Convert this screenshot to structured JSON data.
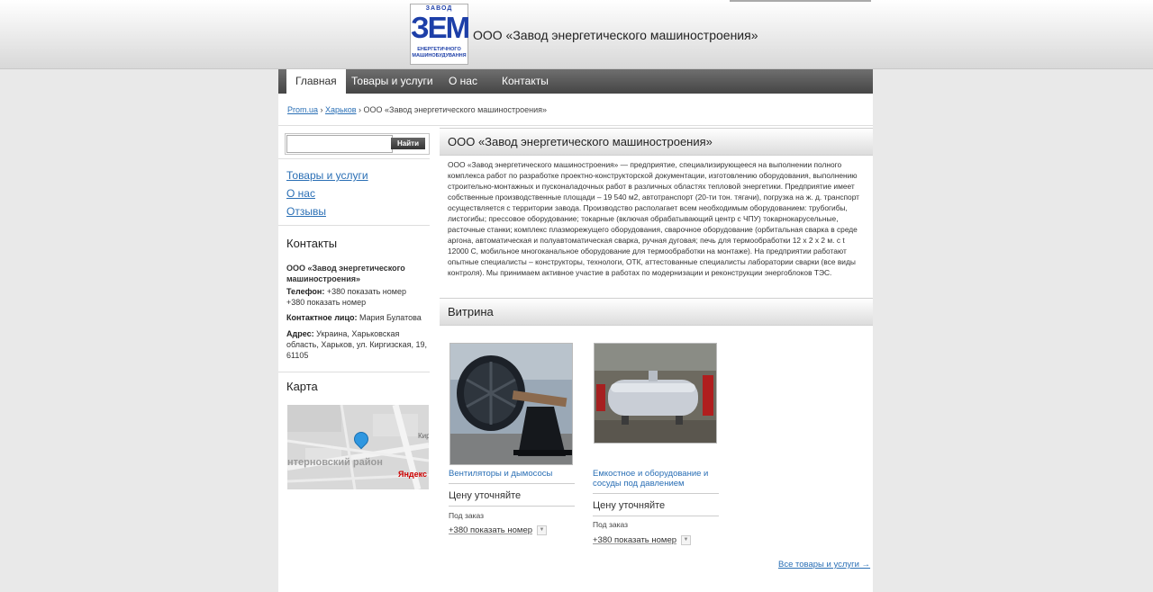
{
  "header": {
    "logo": {
      "top": "ЗАВОД",
      "mark": "ЗЕМ",
      "bottom": "ЕНЕРГЕТИЧНОГО МАШИНОБУДУВАННЯ"
    },
    "title": "ООО «Завод энергетического машиностроения»"
  },
  "nav": [
    {
      "label": "Главная"
    },
    {
      "label": "Товары и услуги"
    },
    {
      "label": "О нас"
    },
    {
      "label": "Контакты"
    }
  ],
  "breadcrumb": {
    "link1": "Prom.ua",
    "sep1": " › ",
    "link2": "Харьков",
    "sep2": " › ",
    "current": "ООО «Завод энергетического машиностроения»"
  },
  "search": {
    "button_label": "Найти",
    "value": ""
  },
  "sidebar": {
    "links": [
      "Товары и услуги",
      "О нас",
      "Отзывы"
    ],
    "contacts_heading": "Контакты",
    "company": "ООО «Завод энергетического машиностроения»",
    "phone_label": "Телефон:",
    "phone1": "+380 показать номер",
    "phone2": "+380 показать номер",
    "person_label": "Контактное лицо:",
    "person": "Мария Булатова",
    "address_label": "Адрес:",
    "address": "Украина, Харьковская область, Харьков, ул. Киргизская, 19, 61105",
    "map_heading": "Карта",
    "map_district": "нтерновский район",
    "map_brand": "Яндекс"
  },
  "main": {
    "title": "ООО «Завод энергетического машиностроения»",
    "description": "ООО «Завод энергетического машиностроения» — предприятие, специализирующееся на выполнении полного комплекса работ по разработке проектно-конструкторской документации, изготовлению оборудования, выполнению строительно-монтажных и пусконаладочных работ в различных областях тепловой энергетики. Предприятие имеет собственные производственные площади – 19 540 м2, автотранспорт (20-ти тон. тягачи), погрузка на ж. д. транспорт осуществляется с территории завода. Производство располагает всем необходимым оборудованием: трубогибы, листогибы; прессовое оборудование; токарные (включая обрабатывающий центр с ЧПУ) токарнокарусельные, расточные станки; комплекс плазморежущего оборудования, сварочное оборудование (орбитальная сварка в среде аргона, автоматическая и полуавтоматическая сварка, ручная дуговая; печь для термообработки 12 х 2 х 2 м. с t 12000 С, мобильное многоканальное оборудование для термообработки на монтаже). На предприятии работают опытные специалисты – конструкторы, технологи, ОТК, аттестованные специалисты лаборатории сварки (все виды контроля). Мы принимаем активное участие в работах по модернизации и реконструкции энергоблоков ТЭС.",
    "showcase_heading": "Витрина",
    "products": [
      {
        "title": "Вентиляторы и дымососы",
        "price": "Цену уточняйте",
        "order": "Под заказ",
        "phone": "+380 показать номер"
      },
      {
        "title": "Емкостное и оборудование и сосуды под давлением",
        "price": "Цену уточняйте",
        "order": "Под заказ",
        "phone": "+380 показать номер"
      }
    ],
    "all_link": "Все товары и услуги →"
  }
}
